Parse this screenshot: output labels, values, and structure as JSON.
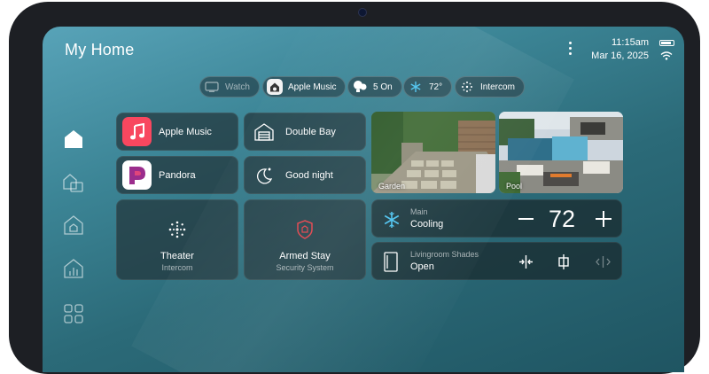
{
  "header": {
    "title": "My Home",
    "time": "11:15am",
    "date": "Mar 16, 2025"
  },
  "status_pills": [
    {
      "label": "Watch",
      "icon": "tv-icon"
    },
    {
      "label": "Apple Music",
      "icon": "speaker-icon"
    },
    {
      "label": "5 On",
      "icon": "lights-icon"
    },
    {
      "label": "72°",
      "icon": "snowflake-icon"
    },
    {
      "label": "Intercom",
      "icon": "intercom-icon"
    }
  ],
  "sidebar": {
    "items": [
      "home-icon",
      "rooms-icon",
      "security-house-icon",
      "energy-chart-icon",
      "apps-grid-icon"
    ]
  },
  "tiles": {
    "apple_music": "Apple Music",
    "double_bay": "Double Bay",
    "pandora": "Pandora",
    "good_night": "Good night",
    "theater": {
      "name": "Theater",
      "sub": "Intercom"
    },
    "armed": {
      "name": "Armed Stay",
      "sub": "Security System"
    }
  },
  "cameras": [
    {
      "label": "Garden"
    },
    {
      "label": "Pool"
    }
  ],
  "climate": {
    "label_small": "Main",
    "mode": "Cooling",
    "setpoint": "72"
  },
  "shades": {
    "label_small": "Livingroom Shades",
    "state": "Open"
  },
  "colors": {
    "accent": "#4cc3ef",
    "alarm": "#e0424b",
    "music": "#f8475f",
    "pandora": "#9b2d8c"
  }
}
